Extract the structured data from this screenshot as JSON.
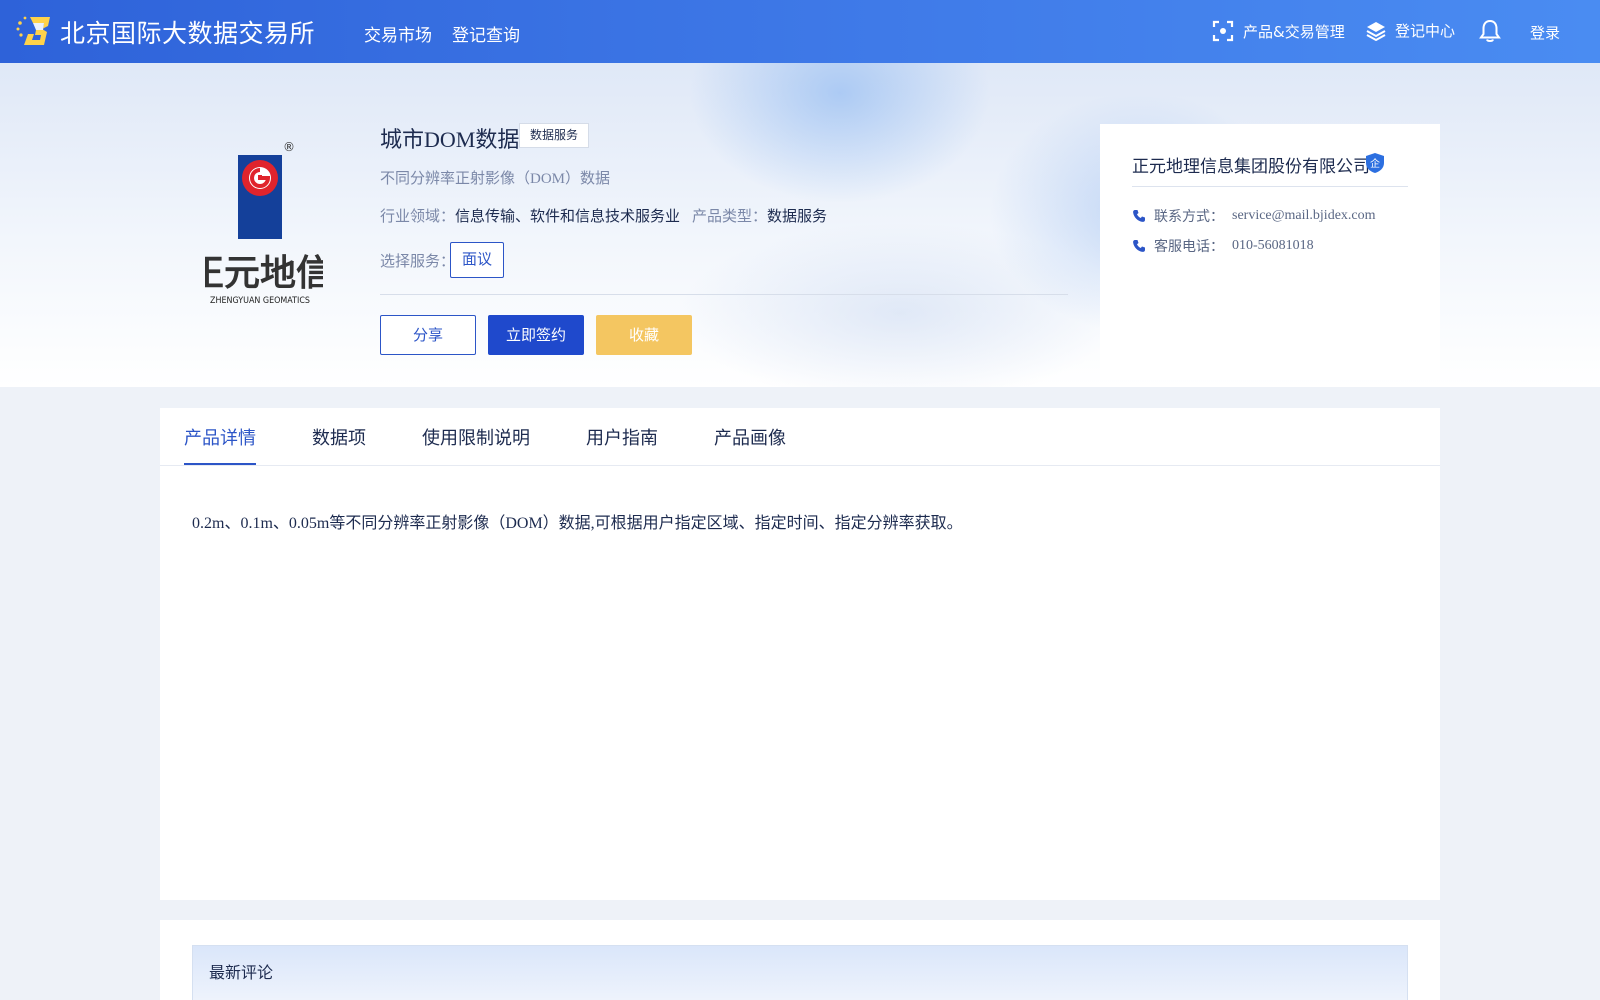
{
  "header": {
    "site_title": "北京国际大数据交易所",
    "nav": [
      "交易市场",
      "登记查询"
    ],
    "product_trade_mgmt": "产品&交易管理",
    "register_center": "登记中心",
    "login": "登录",
    "colors": {
      "bar_start": "#2e62d9",
      "bar_end": "#4a8cf2"
    }
  },
  "brand_logo": {
    "wordmark": "正元地信",
    "subtext": "ZHENGYUAN GEOMATICS",
    "registered_mark": "®",
    "colors": {
      "navy": "#14409a",
      "red": "#e0242c",
      "text": "#333333"
    }
  },
  "product": {
    "title": "城市DOM数据",
    "tag": "数据服务",
    "description": "不同分辨率正射影像（DOM）数据",
    "industry_label": "行业领域：",
    "industry_value": "信息传输、软件和信息技术服务业",
    "type_label": "产品类型：",
    "type_value": "数据服务",
    "service_label": "选择服务：",
    "service_option": "面议"
  },
  "actions": {
    "share": "分享",
    "sign": "立即签约",
    "favorite": "收藏",
    "colors": {
      "primary": "#1f49cc",
      "favorite": "#f4c661"
    }
  },
  "company": {
    "name": "正元地理信息集团股份有限公司",
    "badge": "企",
    "contact_label": "联系方式：",
    "contact_value": "service@mail.bjidex.com",
    "phone_label": "客服电话：",
    "phone_value": "010-56081018"
  },
  "tabs": [
    "产品详情",
    "数据项",
    "使用限制说明",
    "用户指南",
    "产品画像"
  ],
  "active_tab": "产品详情",
  "detail_text": "0.2m、0.1m、0.05m等不同分辨率正射影像（DOM）数据,可根据用户指定区域、指定时间、指定分辨率获取。",
  "comments": {
    "title": "最新评论"
  }
}
